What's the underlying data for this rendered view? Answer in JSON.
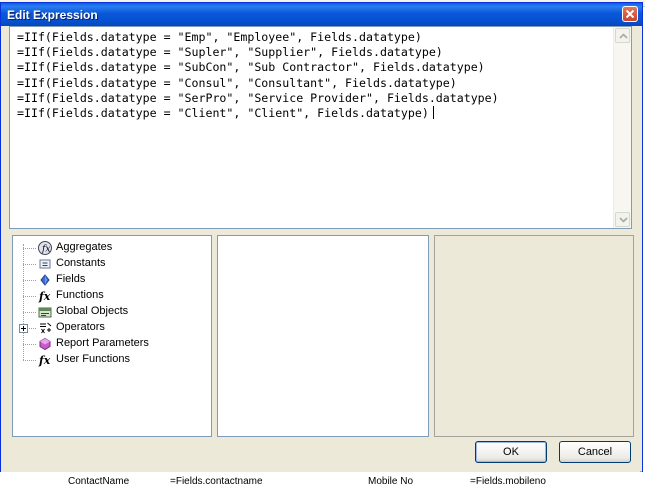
{
  "window": {
    "title": "Edit Expression"
  },
  "editor": {
    "lines": [
      "=IIf(Fields.datatype = \"Emp\", \"Employee\", Fields.datatype)",
      "=IIf(Fields.datatype = \"Supler\", \"Supplier\", Fields.datatype)",
      "=IIf(Fields.datatype = \"SubCon\", \"Sub Contractor\", Fields.datatype)",
      "=IIf(Fields.datatype = \"Consul\", \"Consultant\", Fields.datatype)",
      "=IIf(Fields.datatype = \"SerPro\", \"Service Provider\", Fields.datatype)",
      "=IIf(Fields.datatype = \"Client\", \"Client\", Fields.datatype)"
    ]
  },
  "categories": [
    {
      "label": "Aggregates",
      "icon": "aggregates-icon"
    },
    {
      "label": "Constants",
      "icon": "constants-icon"
    },
    {
      "label": "Fields",
      "icon": "fields-icon"
    },
    {
      "label": "Functions",
      "icon": "functions-icon"
    },
    {
      "label": "Global Objects",
      "icon": "global-objects-icon"
    },
    {
      "label": "Operators",
      "icon": "operators-icon",
      "expandable": true
    },
    {
      "label": "Report Parameters",
      "icon": "report-parameters-icon"
    },
    {
      "label": "User Functions",
      "icon": "user-functions-icon"
    }
  ],
  "buttons": {
    "ok": "OK",
    "cancel": "Cancel"
  },
  "background": {
    "bottom_left": "ContactName",
    "bottom_mid": "=Fields.contactname",
    "bottom_mid2": "Mobile No",
    "bottom_right": "=Fields.mobileno"
  }
}
